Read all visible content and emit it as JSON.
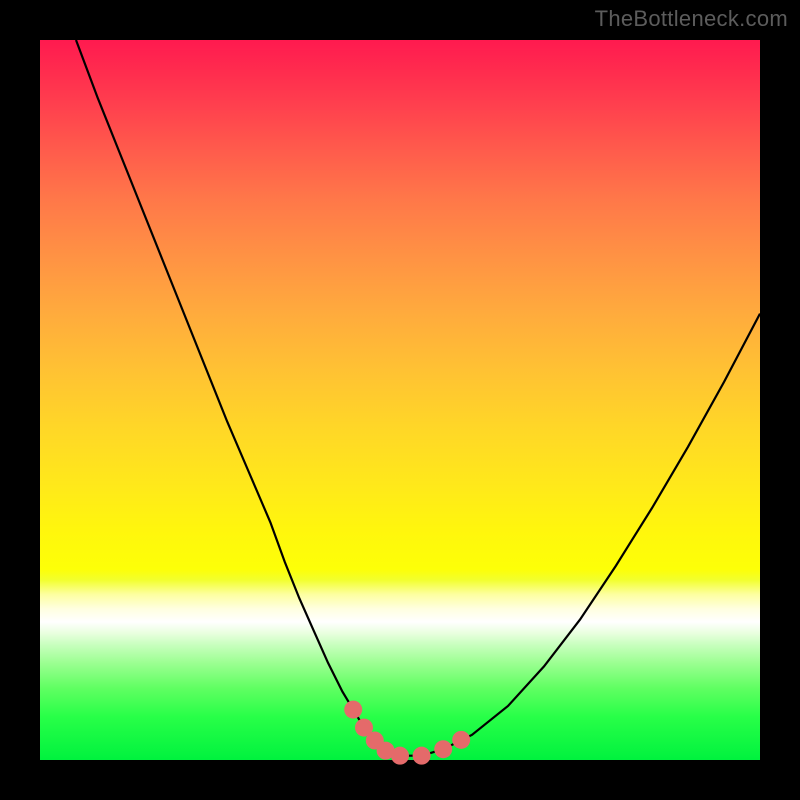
{
  "watermark": "TheBottleneck.com",
  "colors": {
    "curve_stroke": "#000000",
    "marker_fill": "#e46a6a",
    "marker_stroke": "#d85a5a"
  },
  "chart_data": {
    "type": "line",
    "title": "",
    "xlabel": "",
    "ylabel": "",
    "xlim": [
      0,
      100
    ],
    "ylim": [
      0,
      100
    ],
    "series": [
      {
        "name": "bottleneck-curve",
        "x": [
          5,
          8,
          11,
          14,
          17,
          20,
          23,
          26,
          29,
          32,
          34,
          36,
          38,
          40,
          42,
          43.5,
          45,
          46.5,
          48,
          50,
          53,
          56,
          60,
          65,
          70,
          75,
          80,
          85,
          90,
          95,
          100
        ],
        "y": [
          100,
          92,
          84.5,
          77,
          69.5,
          62,
          54.5,
          47,
          40,
          33,
          27.5,
          22.5,
          18,
          13.5,
          9.5,
          7,
          4.5,
          2.7,
          1.3,
          0.6,
          0.6,
          1.5,
          3.5,
          7.5,
          13,
          19.5,
          27,
          35,
          43.5,
          52.5,
          62
        ]
      }
    ],
    "markers": {
      "name": "highlighted-points",
      "points": [
        {
          "x": 43.5,
          "y": 7.0
        },
        {
          "x": 45.0,
          "y": 4.5
        },
        {
          "x": 46.5,
          "y": 2.7
        },
        {
          "x": 48.0,
          "y": 1.3
        },
        {
          "x": 50.0,
          "y": 0.6
        },
        {
          "x": 53.0,
          "y": 0.6
        },
        {
          "x": 56.0,
          "y": 1.5
        },
        {
          "x": 58.5,
          "y": 2.8
        }
      ]
    }
  }
}
